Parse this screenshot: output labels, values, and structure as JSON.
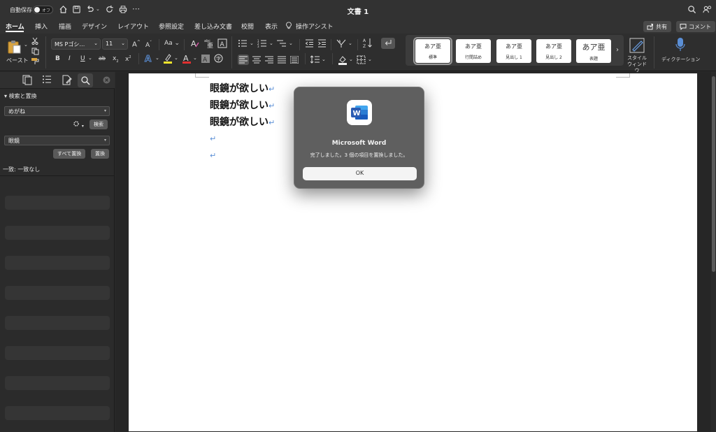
{
  "titlebar": {
    "autosave_label": "自動保存",
    "autosave_state": "オフ",
    "doc_title": "文書 1"
  },
  "tabs": [
    "ホーム",
    "挿入",
    "描画",
    "デザイン",
    "レイアウト",
    "参照設定",
    "差し込み文書",
    "校閲",
    "表示",
    "操作アシスト"
  ],
  "header_buttons": {
    "share": "共有",
    "comment": "コメント"
  },
  "ribbon": {
    "paste_label": "ペースト",
    "font_name": "MS Pゴシ…",
    "font_size": "11",
    "grow_font": "A",
    "shrink_font": "A",
    "change_case": "Aa",
    "bold": "B",
    "italic": "I",
    "underline": "U",
    "strike": "ab",
    "subscript": "x",
    "superscript": "x",
    "styles": [
      {
        "sample": "あア亜",
        "name": "標準"
      },
      {
        "sample": "あア亜",
        "name": "行間詰め"
      },
      {
        "sample": "あア亜",
        "name": "見出し 1"
      },
      {
        "sample": "あア亜",
        "name": "見出し 2"
      },
      {
        "sample": "あア亜",
        "name": "表題"
      }
    ],
    "style_window_label_1": "スタイル",
    "style_window_label_2": "ウィンドウ",
    "dictation_label": "ディクテーション"
  },
  "sidebar": {
    "header": "検索と置換",
    "search_value": "めがね",
    "search_button": "検索",
    "replace_value": "眼鏡",
    "replace_all_button": "すべて置換",
    "replace_button": "置換",
    "result_text": "一致: 一致なし"
  },
  "document": {
    "lines": [
      "眼鏡が欲しい",
      "眼鏡が欲しい",
      "眼鏡が欲しい"
    ],
    "para_mark": "↵"
  },
  "dialog": {
    "title": "Microsoft Word",
    "message": "完了しました。3 個の項目を置換しました。",
    "ok_button": "OK"
  },
  "colors": {
    "word_blue": "#2b5cb3",
    "link_blue": "#5b8fd6"
  }
}
